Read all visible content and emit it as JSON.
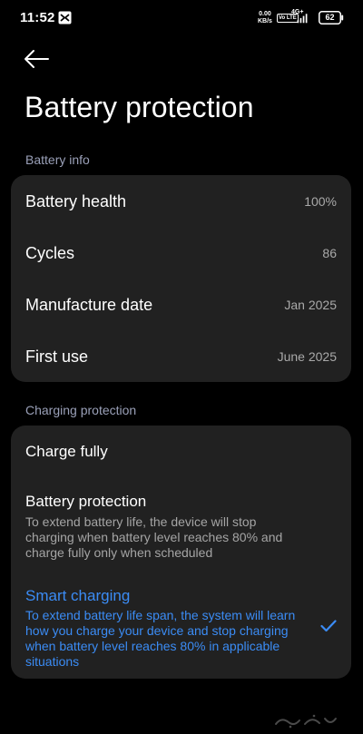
{
  "status_bar": {
    "time": "11:52",
    "net_speed_value": "0.00",
    "net_speed_unit": "KB/s",
    "volte": "Vo LTE",
    "network_type": "4G+",
    "battery_level": "62",
    "icons": [
      "app-notification-icon",
      "signal-icon",
      "battery-icon"
    ]
  },
  "header": {
    "back_icon": "back-arrow-icon",
    "title": "Battery protection"
  },
  "battery_info": {
    "section_title": "Battery info",
    "rows": [
      {
        "label": "Battery health",
        "value": "100%"
      },
      {
        "label": "Cycles",
        "value": "86"
      },
      {
        "label": "Manufacture date",
        "value": "Jan 2025"
      },
      {
        "label": "First use",
        "value": "June 2025"
      }
    ]
  },
  "charging_protection": {
    "section_title": "Charging protection",
    "options": [
      {
        "title": "Charge fully",
        "description": "",
        "selected": false
      },
      {
        "title": "Battery protection",
        "description": "To extend battery life, the device will stop charging when battery level reaches 80% and charge fully only when scheduled",
        "selected": false
      },
      {
        "title": "Smart charging",
        "description": "To extend battery life span, the system will learn how you charge your device and stop charging when battery level reaches 80% in applicable situations",
        "selected": true
      }
    ],
    "selected_icon": "checkmark-icon"
  },
  "colors": {
    "background": "#000000",
    "card": "#212121",
    "section_title": "#9aa0b8",
    "accent": "#3b8cf5",
    "secondary_text": "#a9a9a9"
  }
}
